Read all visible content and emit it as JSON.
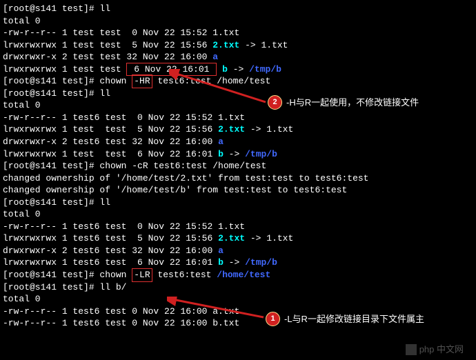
{
  "prompt1": "[root@s141 test]# ll",
  "total0": "total 0",
  "block1": {
    "l1": "-rw-r--r-- 1 test test  0 Nov 22 15:52 1.txt",
    "l2a": "lrwxrwxrwx 1 test test  5 Nov 22 15:56 ",
    "l2b": "2.txt",
    "l2c": " -> 1.txt",
    "l3a": "drwxrwxr-x 2 test test 32 Nov 22 16:00 ",
    "l3b": "a",
    "l4a": "lrwxrwxrwx 1 test test ",
    "l4b": " 6 Nov 22 16:01 ",
    "l4c": "b",
    "l4d": " -> ",
    "l4e": "/tmp/b"
  },
  "cmd_hr_a": "[root@s141 test]# chown ",
  "cmd_hr_box": "-HR",
  "cmd_hr_b": " test6:test /home/test",
  "prompt2": "[root@s141 test]# ll",
  "block2": {
    "l1": "-rw-r--r-- 1 test6 test  0 Nov 22 15:52 1.txt",
    "l2a": "lrwxrwxrwx 1 test  test  5 Nov 22 15:56 ",
    "l2b": "2.txt",
    "l2c": " -> 1.txt",
    "l3a": "drwxrwxr-x 2 test6 test 32 Nov 22 16:00 ",
    "l3b": "a",
    "l4a": "lrwxrwxrwx 1 test  test  6 Nov 22 16:01 ",
    "l4c": "b",
    "l4d": " -> ",
    "l4e": "/tmp/b"
  },
  "cmd_cr": "[root@s141 test]# chown -cR test6:test /home/test",
  "changed1": "changed ownership of '/home/test/2.txt' from test:test to test6:test",
  "changed2": "changed ownership of '/home/test/b' from test:test to test6:test",
  "prompt3": "[root@s141 test]# ll",
  "block3": {
    "l1": "-rw-r--r-- 1 test6 test  0 Nov 22 15:52 1.txt",
    "l2a": "lrwxrwxrwx 1 test6 test  5 Nov 22 15:56 ",
    "l2b": "2.txt",
    "l2c": " -> 1.txt",
    "l3a": "drwxrwxr-x 2 test6 test 32 Nov 22 16:00 ",
    "l3b": "a",
    "l4a": "lrwxrwxrwx 1 test6 test  6 Nov 22 16:01 ",
    "l4c": "b",
    "l4d": " -> ",
    "l4e": "/tmp/b"
  },
  "cmd_lr_a": "[root@s141 test]# chown ",
  "cmd_lr_box": "-LR",
  "cmd_lr_b": " test6:test ",
  "cmd_lr_path": "/home/test",
  "prompt4": "[root@s141 test]# ll b/",
  "block4": {
    "l1": "-rw-r--r-- 1 test6 test 0 Nov 22 16:00 a.txt",
    "l2": "-rw-r--r-- 1 test6 test 0 Nov 22 16:00 b.txt"
  },
  "annot2_num": "2",
  "annot2_text": "-H与R一起使用，不修改链接文件",
  "annot1_num": "1",
  "annot1_text": "-L与R一起修改链接目录下文件属主",
  "watermark": "php 中文网"
}
